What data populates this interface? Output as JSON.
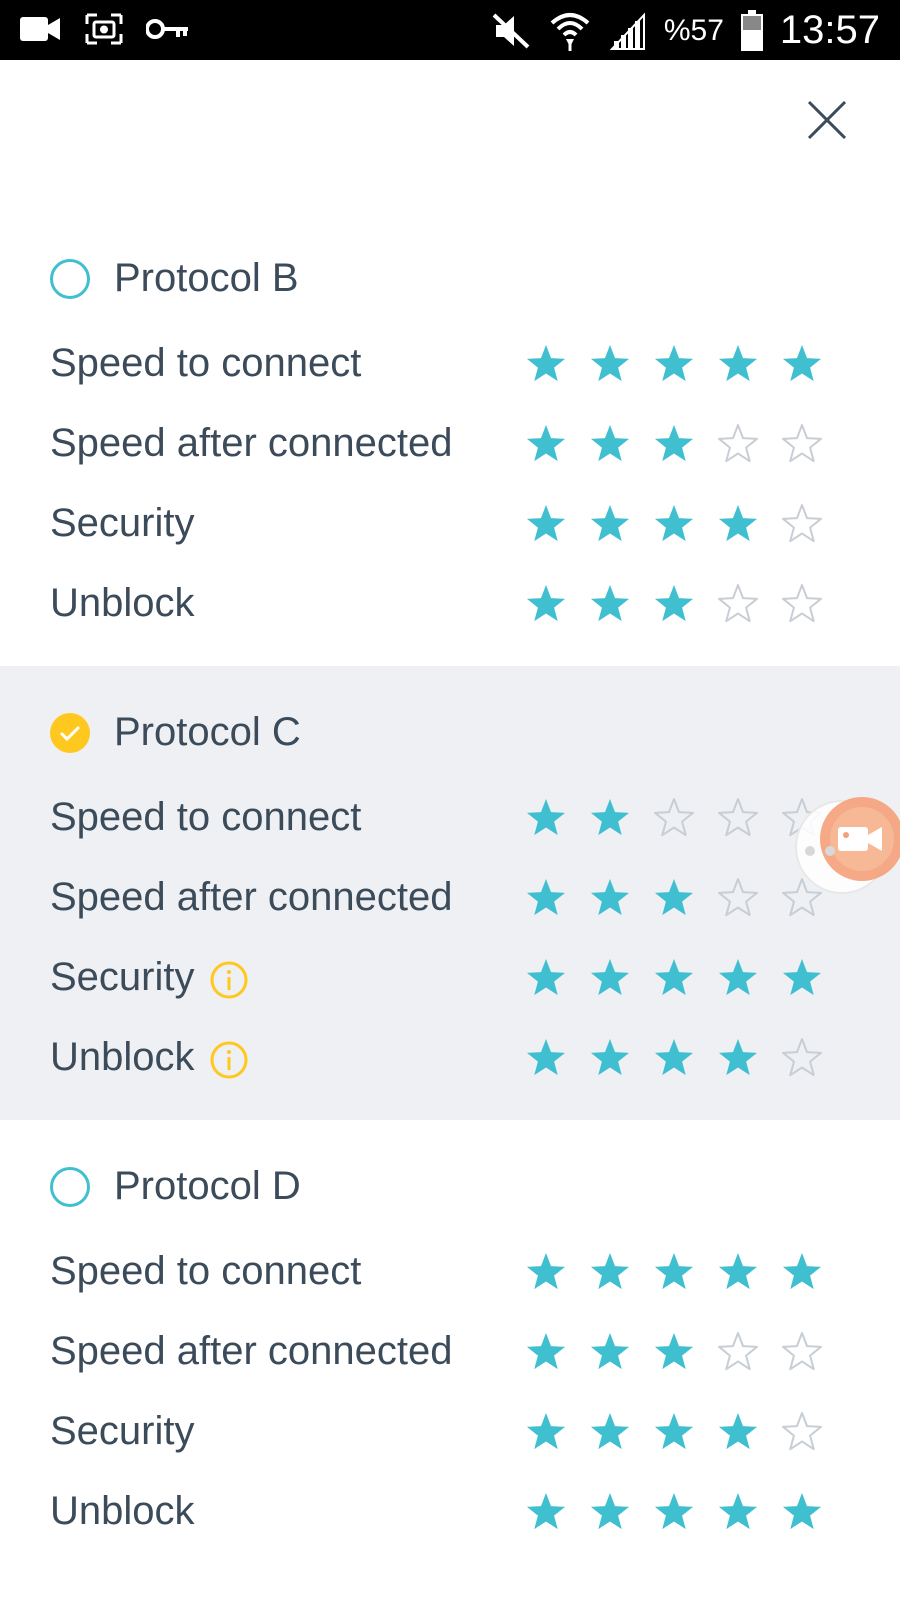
{
  "status_bar": {
    "battery": "%57",
    "time": "13:57"
  },
  "colors": {
    "star_filled": "#3fbfcf",
    "star_empty_stroke": "#c8ced6",
    "radio": "#3fbfcf",
    "selected_check": "#ffc81e",
    "info": "#ffc81e",
    "selected_bg": "#eef0f3",
    "text": "#3c4b5a"
  },
  "max_stars": 5,
  "protocols": [
    {
      "name": "Protocol B",
      "selected": false,
      "ratings": [
        {
          "label": "Speed to connect",
          "stars": 5,
          "info": false
        },
        {
          "label": "Speed after connected",
          "stars": 3,
          "info": false
        },
        {
          "label": "Security",
          "stars": 4,
          "info": false
        },
        {
          "label": "Unblock",
          "stars": 3,
          "info": false
        }
      ]
    },
    {
      "name": "Protocol C",
      "selected": true,
      "ratings": [
        {
          "label": "Speed to connect",
          "stars": 2,
          "info": false
        },
        {
          "label": "Speed after connected",
          "stars": 3,
          "info": false
        },
        {
          "label": "Security",
          "stars": 5,
          "info": true
        },
        {
          "label": "Unblock",
          "stars": 4,
          "info": true
        }
      ]
    },
    {
      "name": "Protocol D",
      "selected": false,
      "ratings": [
        {
          "label": "Speed to connect",
          "stars": 5,
          "info": false
        },
        {
          "label": "Speed after connected",
          "stars": 3,
          "info": false
        },
        {
          "label": "Security",
          "stars": 4,
          "info": false
        },
        {
          "label": "Unblock",
          "stars": 5,
          "info": false
        }
      ]
    }
  ]
}
